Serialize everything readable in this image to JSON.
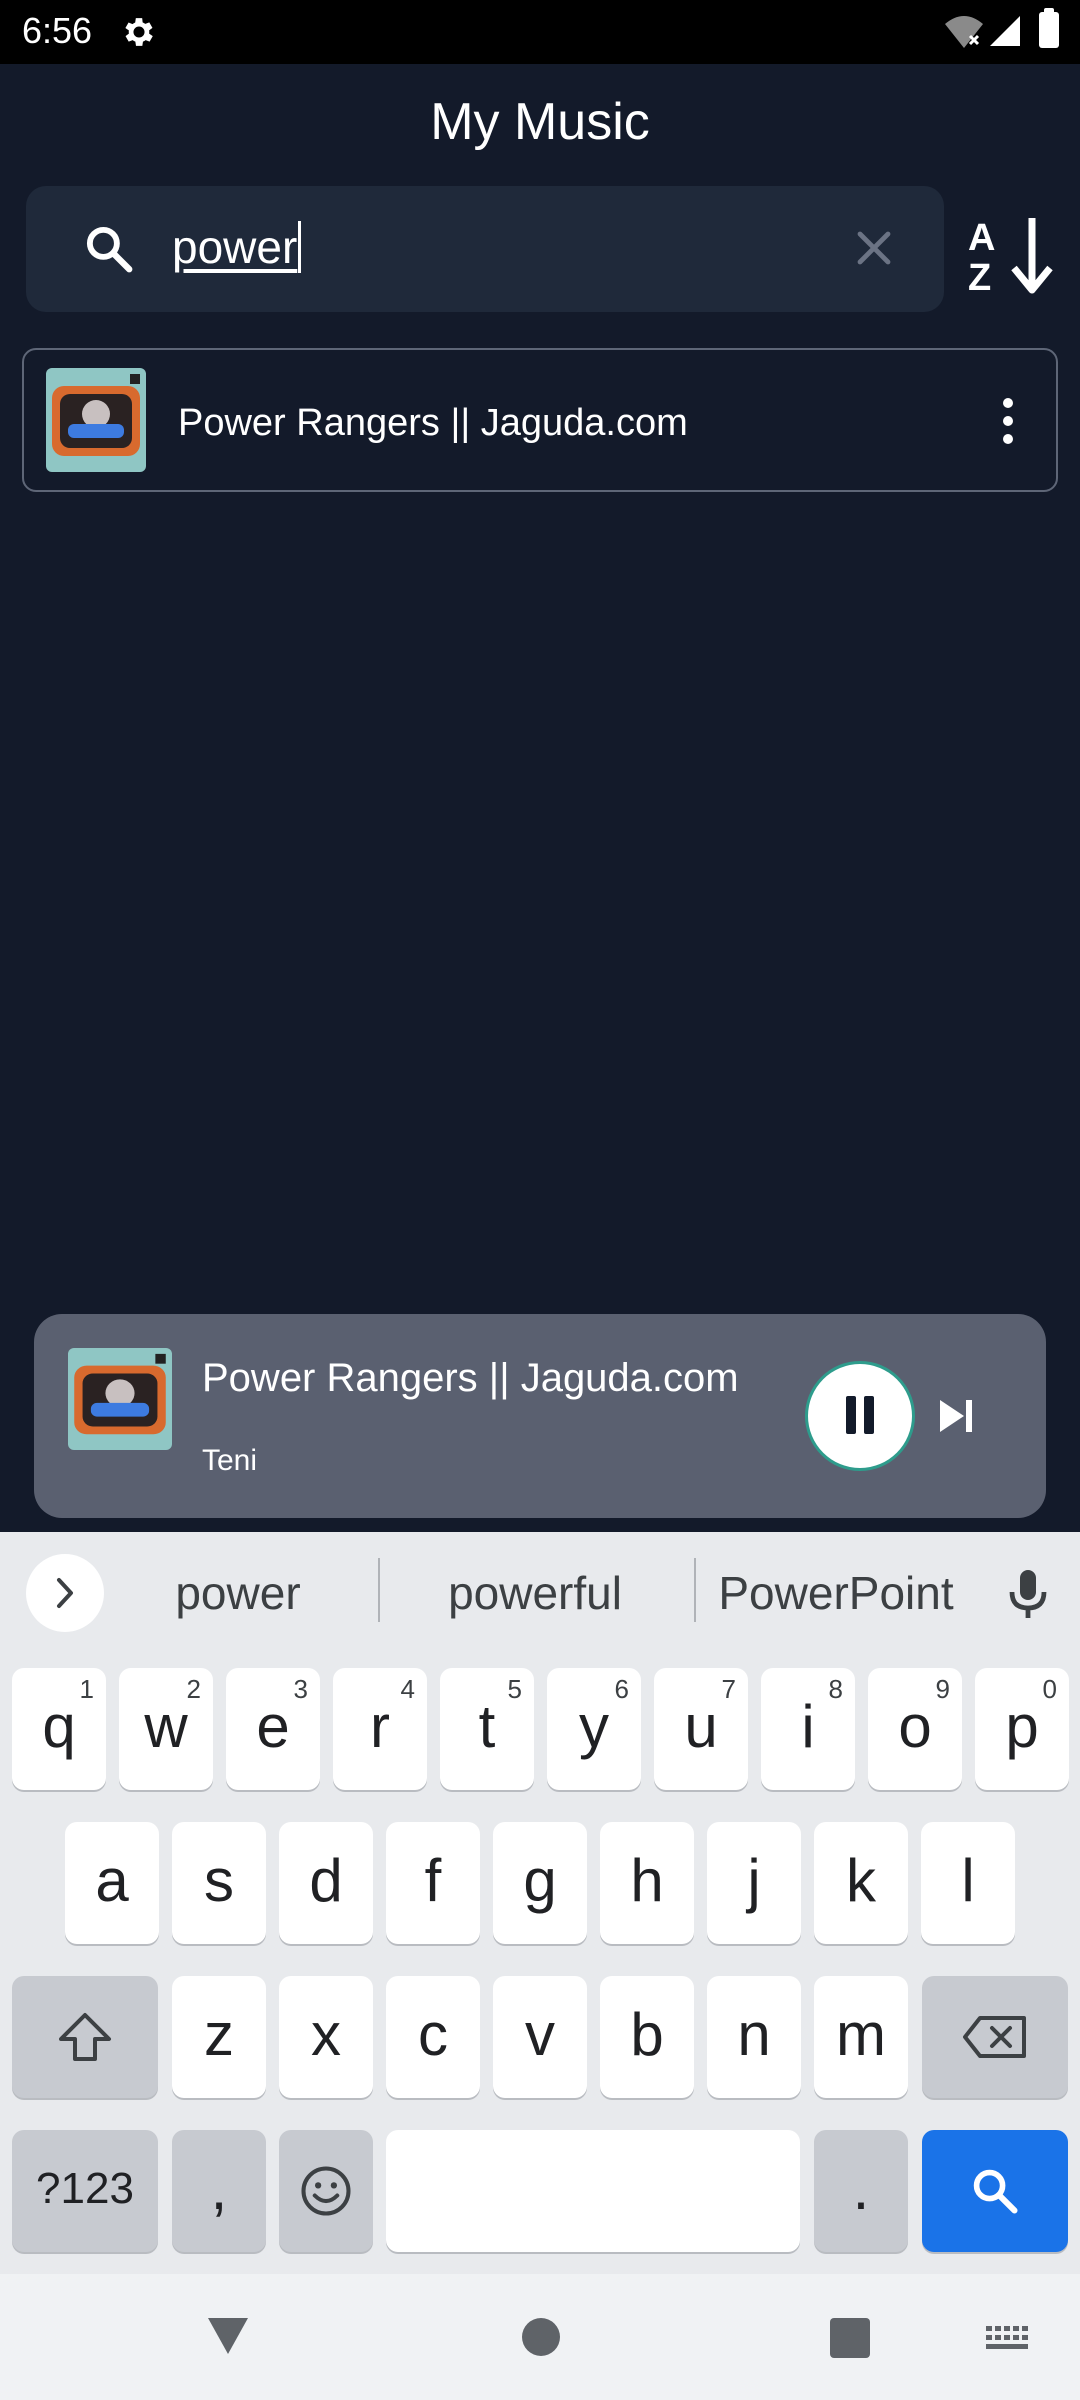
{
  "status": {
    "time": "6:56"
  },
  "header": {
    "title": "My Music"
  },
  "search": {
    "query": "power"
  },
  "results": [
    {
      "title": "Power Rangers || Jaguda.com"
    }
  ],
  "player": {
    "title": "Power Rangers || Jaguda.com",
    "artist": "Teni",
    "state": "playing"
  },
  "keyboard": {
    "suggestions": [
      "power",
      "powerful",
      "PowerPoint"
    ],
    "row1": [
      {
        "k": "q",
        "n": "1"
      },
      {
        "k": "w",
        "n": "2"
      },
      {
        "k": "e",
        "n": "3"
      },
      {
        "k": "r",
        "n": "4"
      },
      {
        "k": "t",
        "n": "5"
      },
      {
        "k": "y",
        "n": "6"
      },
      {
        "k": "u",
        "n": "7"
      },
      {
        "k": "i",
        "n": "8"
      },
      {
        "k": "o",
        "n": "9"
      },
      {
        "k": "p",
        "n": "0"
      }
    ],
    "row2": [
      "a",
      "s",
      "d",
      "f",
      "g",
      "h",
      "j",
      "k",
      "l"
    ],
    "row3": [
      "z",
      "x",
      "c",
      "v",
      "b",
      "n",
      "m"
    ],
    "symbols_label": "?123",
    "comma": ",",
    "period": "."
  },
  "colors": {
    "background": "#131a2a",
    "accent": "#1a73e8",
    "player_bg": "#5a6070"
  }
}
